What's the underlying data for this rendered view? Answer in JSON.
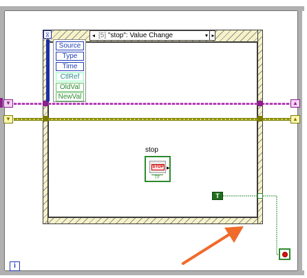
{
  "event_structure": {
    "case_index": "[5]",
    "case_name": "\"stop\": Value Change",
    "left_arrow": "◂",
    "dropdown": "▾",
    "right_arrow": "▸"
  },
  "event_data_node": {
    "items": [
      "Source",
      "Type",
      "Time",
      "CtlRef",
      "OldVal",
      "NewVal"
    ]
  },
  "stop_terminal": {
    "label": "stop",
    "button_text": "STOP",
    "type_text": "TF"
  },
  "true_constant": {
    "text": "T"
  },
  "iteration_terminal": {
    "text": "i"
  },
  "hourglass": {
    "text": "⧖"
  },
  "colors": {
    "boolean_green": "#2c8a2c",
    "refnum_purple": "#b040b0",
    "cluster_yellow": "#a0a000",
    "annotation_orange": "#f06a2a"
  }
}
